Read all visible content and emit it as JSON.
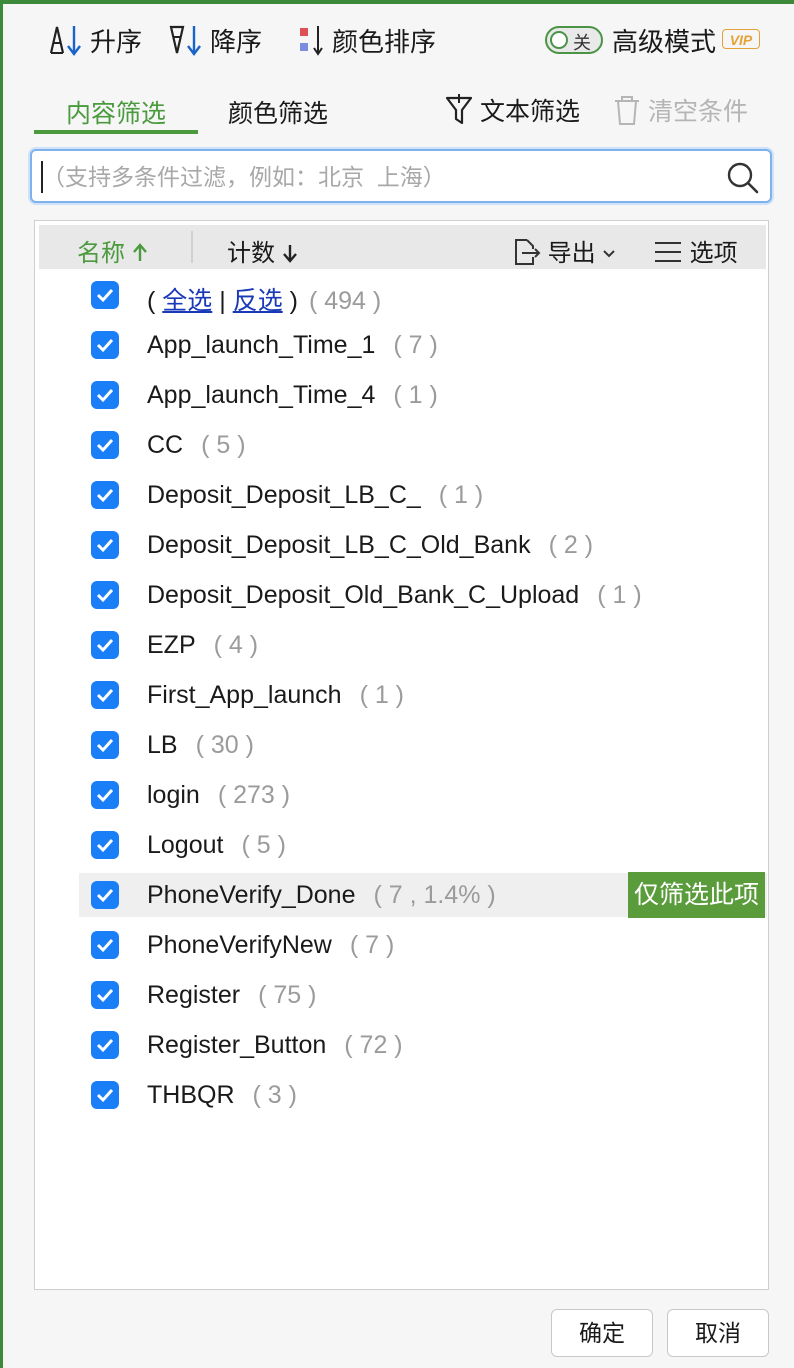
{
  "toolbar": {
    "sort_asc": "升序",
    "sort_desc": "降序",
    "color_sort": "颜色排序",
    "toggle_state": "关",
    "advanced_mode": "高级模式",
    "vip": "VIP"
  },
  "tabs": {
    "content_filter": "内容筛选",
    "color_filter": "颜色筛选",
    "text_filter": "文本筛选",
    "clear_conditions": "清空条件"
  },
  "search": {
    "placeholder": "（支持多条件过滤，例如：北京  上海）",
    "value": ""
  },
  "list_header": {
    "name": "名称",
    "count": "计数",
    "export": "导出",
    "options": "选项"
  },
  "select_all_row": {
    "open": "(",
    "select_all": "全选",
    "sep": "|",
    "invert": "反选",
    "close": ")",
    "count": "( 494 )"
  },
  "items": [
    {
      "name": "App_launch_Time_1",
      "count": "( 7 )"
    },
    {
      "name": "App_launch_Time_4",
      "count": "( 1 )"
    },
    {
      "name": "CC",
      "count": "( 5 )"
    },
    {
      "name": "Deposit_Deposit_LB_C_",
      "count": "( 1 )"
    },
    {
      "name": "Deposit_Deposit_LB_C_Old_Bank",
      "count": "( 2 )"
    },
    {
      "name": "Deposit_Deposit_Old_Bank_C_Upload",
      "count": "( 1 )"
    },
    {
      "name": "EZP",
      "count": "( 4 )"
    },
    {
      "name": "First_App_launch",
      "count": "( 1 )"
    },
    {
      "name": "LB",
      "count": "( 30 )"
    },
    {
      "name": "login",
      "count": "( 273 )"
    },
    {
      "name": "Logout",
      "count": "( 5 )"
    },
    {
      "name": "PhoneVerify_Done",
      "count": "( 7 , 1.4% )"
    },
    {
      "name": "PhoneVerifyNew",
      "count": "( 7 )"
    },
    {
      "name": "Register",
      "count": "( 75 )"
    },
    {
      "name": "Register_Button",
      "count": "( 72 )"
    },
    {
      "name": "THBQR",
      "count": "( 3 )"
    }
  ],
  "hover_action": "仅筛选此项",
  "buttons": {
    "ok": "确定",
    "cancel": "取消"
  },
  "colors": {
    "accent_green": "#4b9a3d",
    "checkbox_blue": "#1a7ef7",
    "vip_orange": "#e4a23a",
    "link_blue": "#1a39b8"
  }
}
